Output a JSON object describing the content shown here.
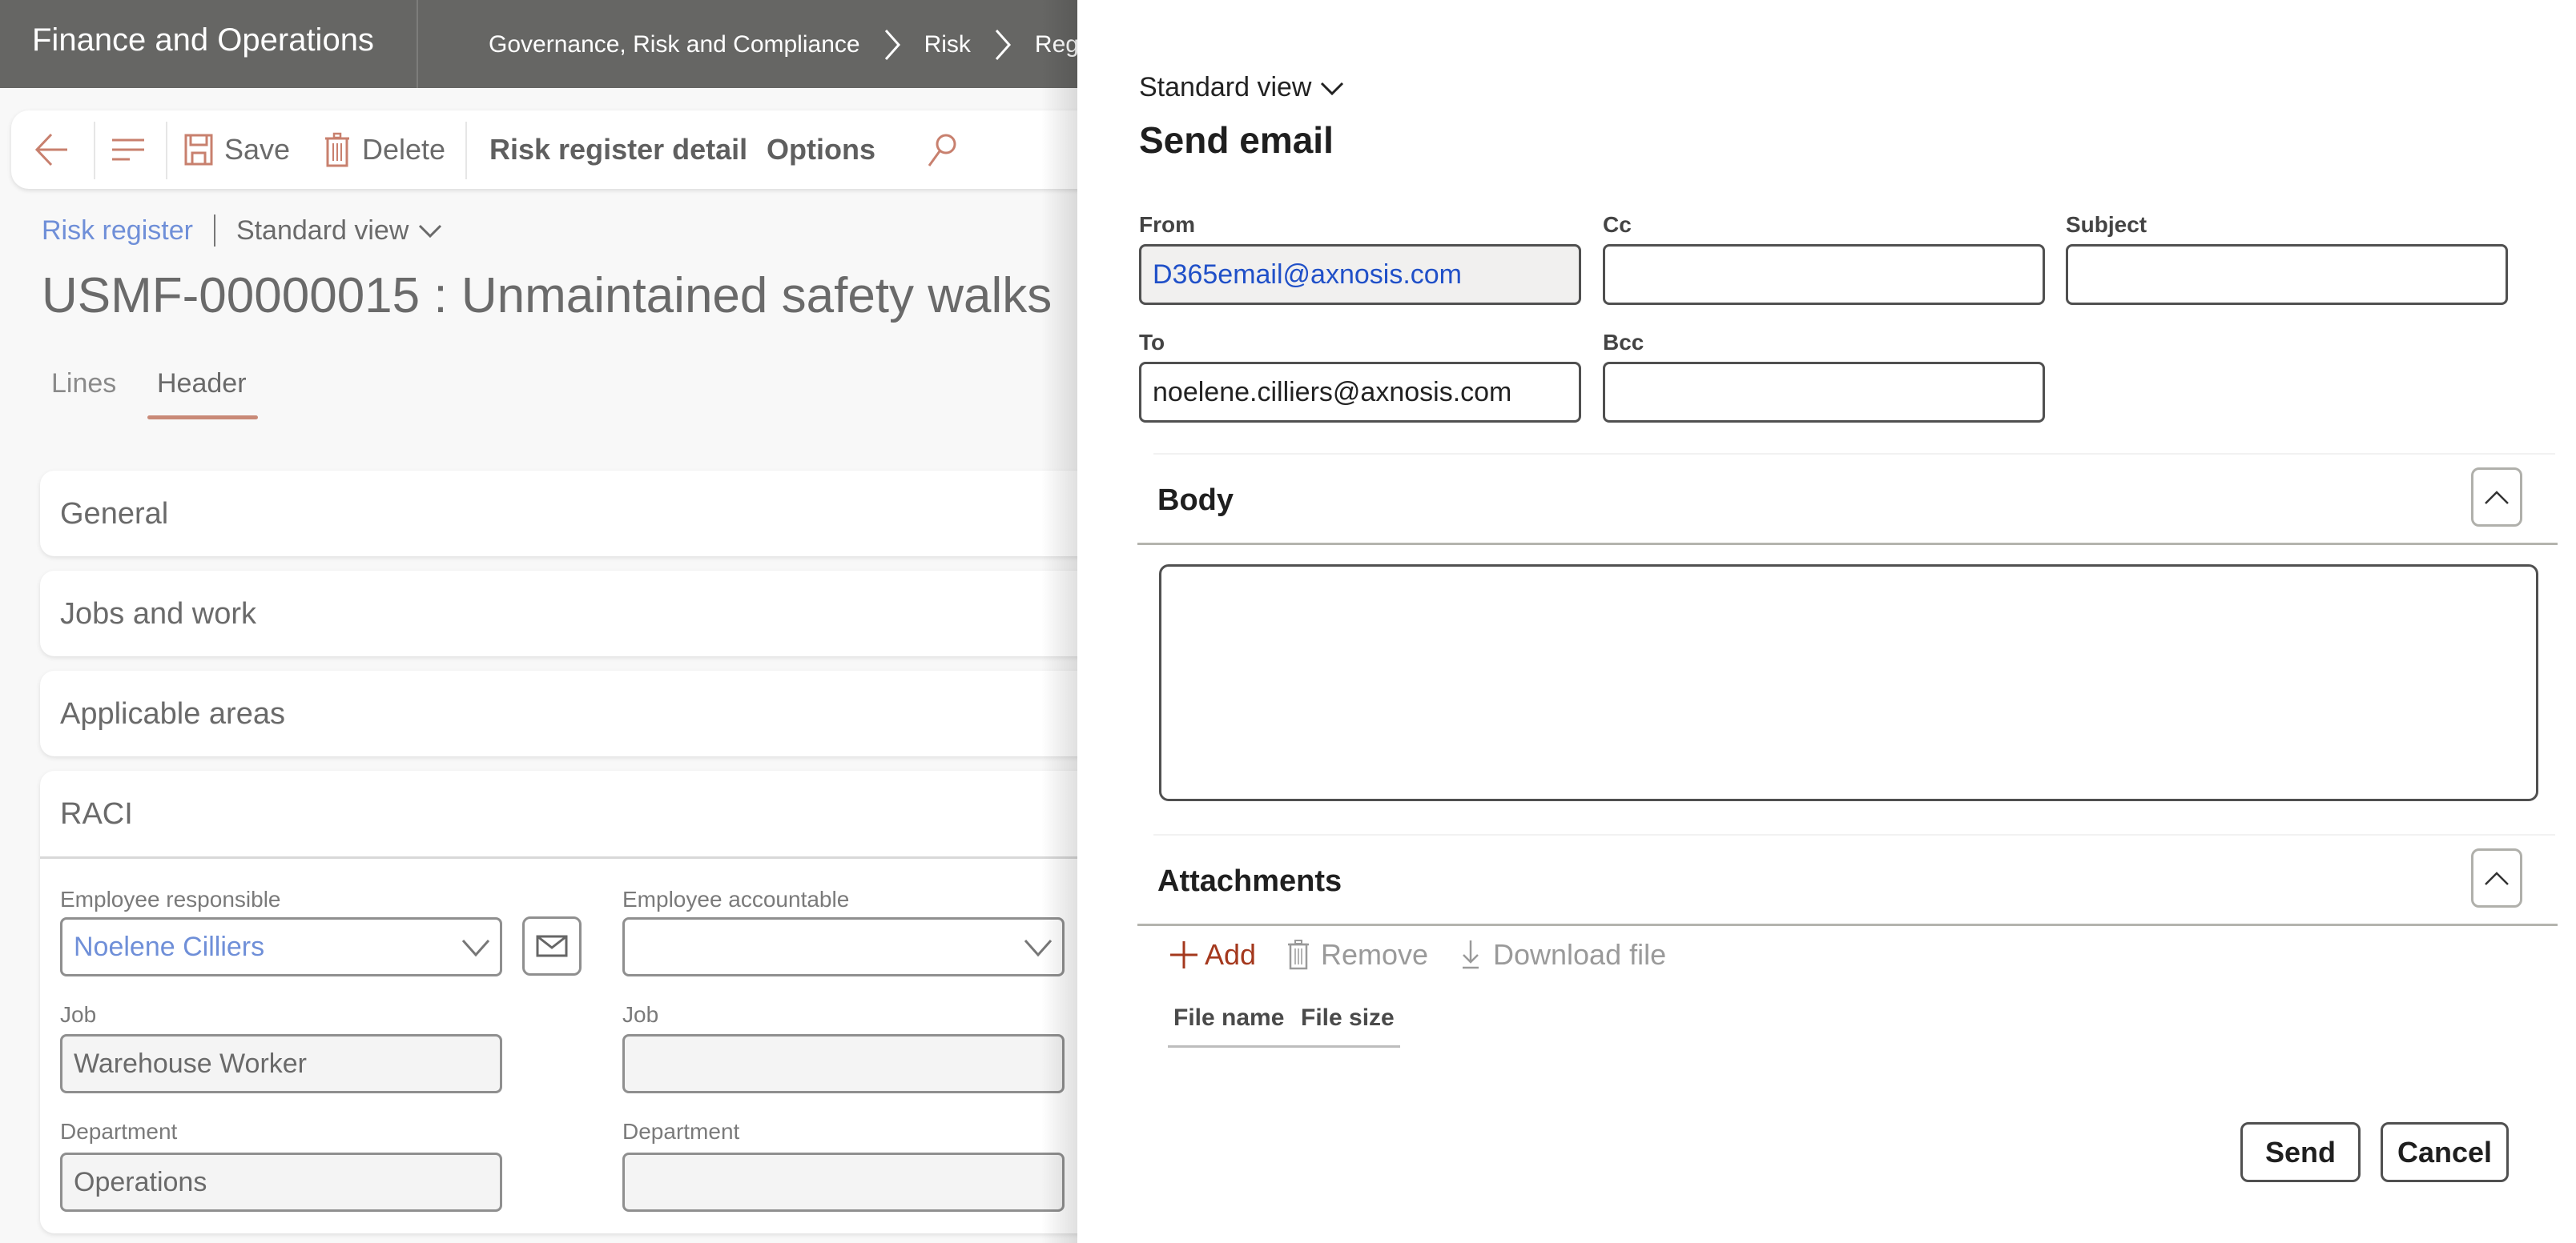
{
  "app": {
    "title": "Finance and Operations",
    "breadcrumb": [
      "Governance, Risk and Compliance",
      "Risk",
      "Regi"
    ]
  },
  "toolbar": {
    "back_label": "Back",
    "menu_label": "Menu",
    "save_label": "Save",
    "delete_label": "Delete",
    "risk_register_detail_label": "Risk register detail",
    "options_label": "Options",
    "search_label": "Search"
  },
  "page": {
    "nav_link": "Risk register",
    "view_selector": "Standard view",
    "title": "USMF-00000015 : Unmaintained safety walks",
    "tabs": [
      {
        "label": "Lines",
        "active": false
      },
      {
        "label": "Header",
        "active": true
      }
    ],
    "sections": [
      {
        "title": "General"
      },
      {
        "title": "Jobs and work"
      },
      {
        "title": "Applicable areas"
      },
      {
        "title": "RACI"
      }
    ],
    "raci": {
      "responsible": {
        "employee_label": "Employee responsible",
        "employee_value": "Noelene Cilliers",
        "job_label": "Job",
        "job_value": "Warehouse Worker",
        "department_label": "Department",
        "department_value": "Operations"
      },
      "accountable": {
        "employee_label": "Employee accountable",
        "employee_value": "",
        "job_label": "Job",
        "job_value": "",
        "department_label": "Department",
        "department_value": ""
      }
    }
  },
  "dialog": {
    "view_selector": "Standard view",
    "title": "Send email",
    "fields": {
      "from": {
        "label": "From",
        "value": "D365email@axnosis.com"
      },
      "cc": {
        "label": "Cc",
        "value": ""
      },
      "subject": {
        "label": "Subject",
        "value": ""
      },
      "to": {
        "label": "To",
        "value": "noelene.cilliers@axnosis.com"
      },
      "bcc": {
        "label": "Bcc",
        "value": ""
      }
    },
    "body_section": {
      "title": "Body",
      "value": ""
    },
    "attachments_section": {
      "title": "Attachments",
      "actions": {
        "add": "Add",
        "remove": "Remove",
        "download": "Download file"
      },
      "columns": [
        "File name",
        "File size"
      ],
      "rows": []
    },
    "buttons": {
      "send": "Send",
      "cancel": "Cancel"
    }
  },
  "colors": {
    "topbar": "#666664",
    "accent_icon": "#c8806e",
    "link_blue": "#6f8fd8",
    "from_value_blue": "#2050c8",
    "add_action": "#a4381d"
  }
}
